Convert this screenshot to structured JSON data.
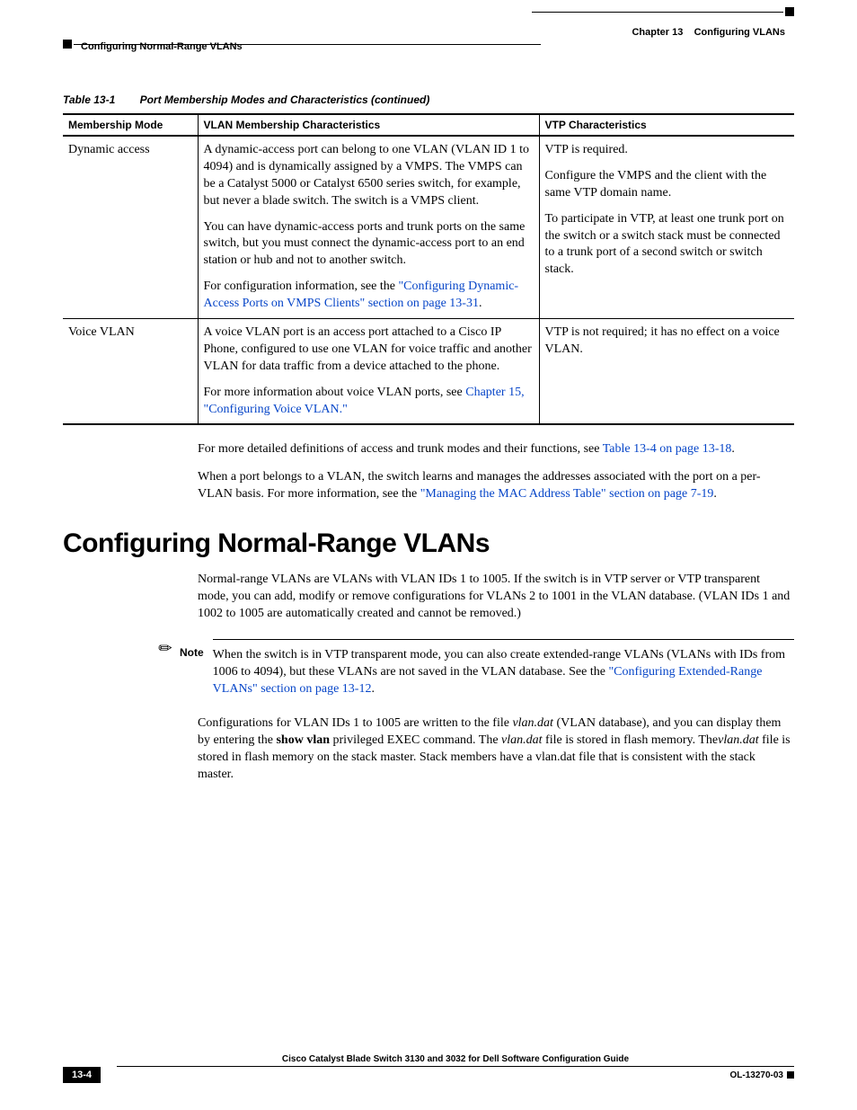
{
  "header": {
    "chapter_label": "Chapter 13",
    "chapter_title": "Configuring VLANs",
    "section_left": "Configuring Normal-Range VLANs"
  },
  "table_caption": {
    "label": "Table 13-1",
    "title": "Port Membership Modes and Characteristics (continued)"
  },
  "table_headers": {
    "col1": "Membership Mode",
    "col2": "VLAN Membership Characteristics",
    "col3": "VTP Characteristics"
  },
  "row1": {
    "mode": "Dynamic access",
    "char_p1": "A dynamic-access port can belong to one VLAN (VLAN ID 1 to 4094) and is dynamically assigned by a VMPS. The VMPS can be a Catalyst 5000 or Catalyst 6500 series switch, for example, but never a blade switch. The switch is a VMPS client.",
    "char_p2": "You can have dynamic-access ports and trunk ports on the same switch, but you must connect the dynamic-access port to an end station or hub and not to another switch.",
    "char_p3a": "For configuration information, see the ",
    "char_p3_link": "\"Configuring Dynamic-Access Ports on VMPS Clients\" section on page 13-31",
    "char_p3b": ".",
    "vtp_p1": "VTP is required.",
    "vtp_p2": "Configure the VMPS and the client with the same VTP domain name.",
    "vtp_p3": "To participate in VTP, at least one trunk port on the switch or a switch stack must be connected to a trunk port of a second switch or switch stack."
  },
  "row2": {
    "mode": "Voice VLAN",
    "char_p1": "A voice VLAN port is an access port attached to a Cisco IP Phone, configured to use one VLAN for voice traffic and another VLAN for data traffic from a device attached to the phone.",
    "char_p2a": "For more information about voice VLAN ports, see ",
    "char_p2_link": "Chapter 15, \"Configuring Voice VLAN.\"",
    "vtp_p1": "VTP is not required; it has no effect on a voice VLAN."
  },
  "after_table": {
    "p1a": "For more detailed definitions of access and trunk modes and their functions, see ",
    "p1_link": "Table 13-4 on page 13-18",
    "p1b": ".",
    "p2a": "When a port belongs to a VLAN, the switch learns and manages the addresses associated with the port on a per-VLAN basis. For more information, see the ",
    "p2_link": "\"Managing the MAC Address Table\" section on page 7-19",
    "p2b": "."
  },
  "section_heading": "Configuring Normal-Range VLANs",
  "section_intro": "Normal-range VLANs are VLANs with VLAN IDs 1 to 1005. If the switch is in VTP server or VTP transparent mode, you can add, modify or remove configurations for VLANs 2 to 1001 in the VLAN database. (VLAN IDs 1 and 1002 to 1005 are automatically created and cannot be removed.)",
  "note": {
    "label": "Note",
    "body_a": "When the switch is in VTP transparent mode, you can also create extended-range VLANs (VLANs with IDs from 1006 to 4094), but these VLANs are not saved in the VLAN database. See the ",
    "body_link": "\"Configuring Extended-Range VLANs\" section on page 13-12",
    "body_b": "."
  },
  "para2": {
    "a": "Configurations for VLAN IDs 1 to 1005 are written to the file ",
    "i1": "vlan.dat",
    "b": " (VLAN database), and you can display them by entering the ",
    "bold1": "show vlan",
    "c": " privileged EXEC command. The ",
    "i2": "vlan.dat",
    "d": " file is stored in flash memory. The",
    "i3": "vlan.dat",
    "e": " file is stored in flash memory on the stack master. Stack members have a vlan.dat file that is consistent with the stack master."
  },
  "footer": {
    "guide": "Cisco Catalyst Blade Switch 3130 and 3032 for Dell Software Configuration Guide",
    "page": "13-4",
    "doc": "OL-13270-03"
  }
}
